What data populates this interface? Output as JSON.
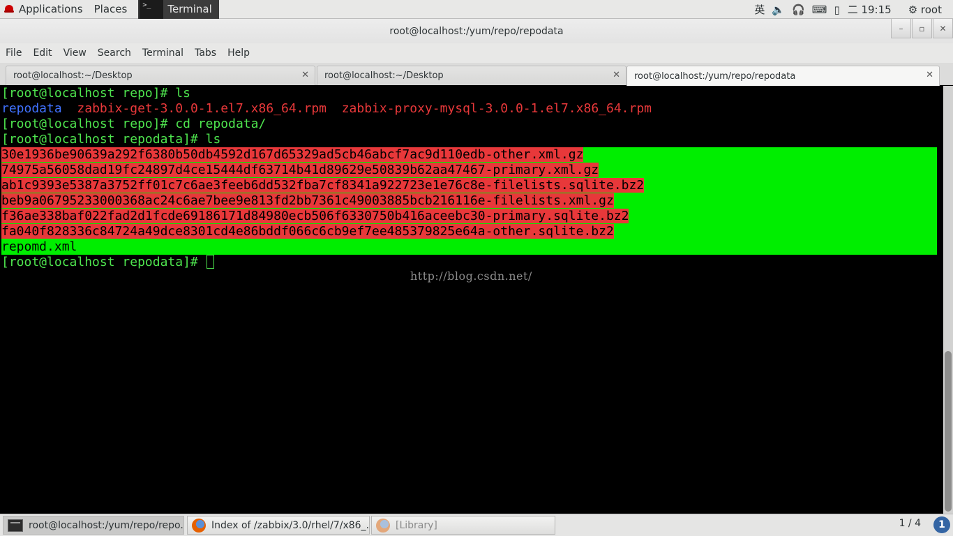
{
  "top_panel": {
    "applications": "Applications",
    "places": "Places",
    "terminal": "Terminal",
    "input_method": "英",
    "clock": "二 19:15",
    "user": "root"
  },
  "window": {
    "title": "root@localhost:/yum/repo/repodata",
    "minimize": "–",
    "maximize": "▫",
    "close": "✕"
  },
  "menu": [
    "File",
    "Edit",
    "View",
    "Search",
    "Terminal",
    "Tabs",
    "Help"
  ],
  "tabs": [
    {
      "label": "root@localhost:~/Desktop"
    },
    {
      "label": "root@localhost:~/Desktop"
    },
    {
      "label": "root@localhost:/yum/repo/repodata"
    }
  ],
  "terminal": {
    "prompt_repo": "[root@localhost repo]# ",
    "cmd_ls": "ls",
    "dir_repodata": "repodata",
    "rpm_get": "zabbix-get-3.0.0-1.el7.x86_64.rpm",
    "rpm_proxy": "zabbix-proxy-mysql-3.0.0-1.el7.x86_64.rpm",
    "cmd_cd": "cd repodata/",
    "prompt_repodata": "[root@localhost repodata]# ",
    "files": [
      "30e1936be90639a292f6380b50db4592d167d65329ad5cb46abcf7ac9d110edb-other.xml.gz",
      "74975a56058dad19fc24897d4ce15444df63714b41d89629e50839b62aa47467-primary.xml.gz",
      "ab1c9393e5387a3752ff01c7c6ae3feeb6dd532fba7cf8341a922723e1e76c8e-filelists.sqlite.bz2",
      "beb9a06795233000368ac24c6ae7bee9e813fd2bb7361c49003885bcb216116e-filelists.xml.gz",
      "f36ae338baf022fad2d1fcde69186171d84980ecb506f6330750b416aceebc30-primary.sqlite.bz2",
      "fa040f828336c84724a49dce8301cd4e86bddf066c6cb9ef7ee485379825e64a-other.sqlite.bz2"
    ],
    "repomd": "repomd.xml",
    "watermark": "http://blog.csdn.net/"
  },
  "taskbar": {
    "tasks": [
      {
        "label": "root@localhost:/yum/repo/repo..."
      },
      {
        "label": "Index of /zabbix/3.0/rhel/7/x86_..."
      },
      {
        "label": "[Library]"
      }
    ],
    "pager": "1 / 4",
    "notifications": "1"
  },
  "colors": {
    "prompt_green": "#4ee44e",
    "dir_blue": "#4072ff",
    "rpm_red": "#e8383a",
    "highlight_green": "#00ee00"
  }
}
